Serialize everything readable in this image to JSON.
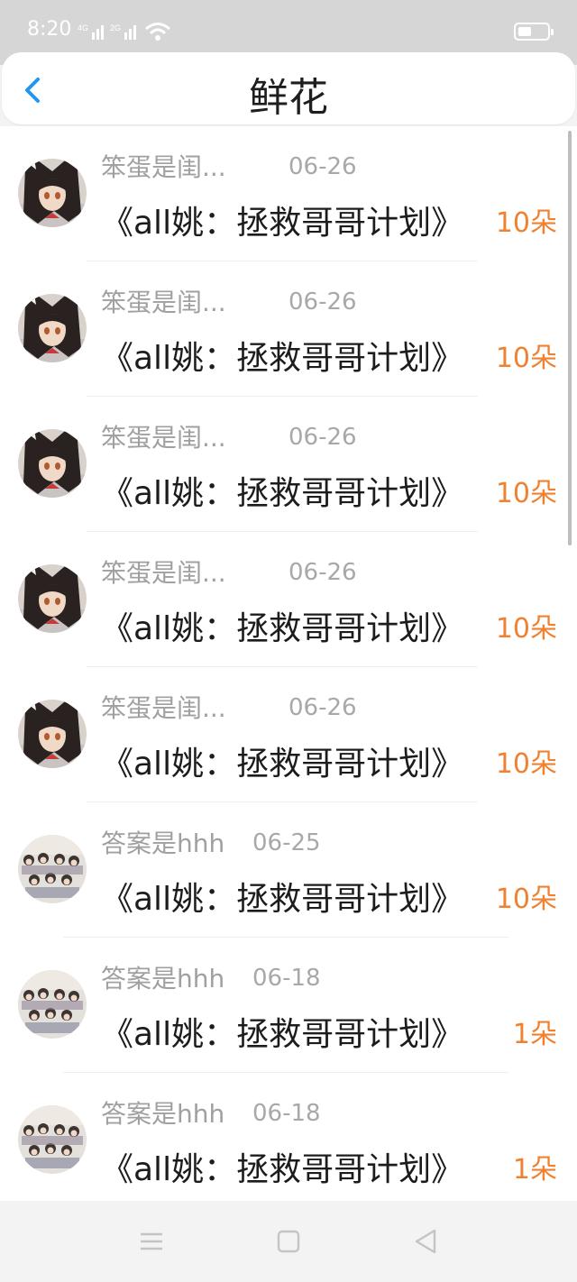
{
  "status_bar": {
    "time": "8:20",
    "signal_1": "4G",
    "signal_2": "2G",
    "icons": [
      "signal-icon",
      "wifi-icon",
      "battery-icon"
    ]
  },
  "header": {
    "title": "鲜花",
    "back_icon": "chevron-left-icon"
  },
  "colors": {
    "accent": "#2196f3",
    "count": "#f08130",
    "muted": "#a0a0a0"
  },
  "items": [
    {
      "user": "笨蛋是闺...",
      "date": "06-26",
      "title": "《all姚：拯救哥哥计划》",
      "count": "10朵",
      "avatar": "anime-girl-avatar"
    },
    {
      "user": "笨蛋是闺...",
      "date": "06-26",
      "title": "《all姚：拯救哥哥计划》",
      "count": "10朵",
      "avatar": "anime-girl-avatar"
    },
    {
      "user": "笨蛋是闺...",
      "date": "06-26",
      "title": "《all姚：拯救哥哥计划》",
      "count": "10朵",
      "avatar": "anime-girl-avatar"
    },
    {
      "user": "笨蛋是闺...",
      "date": "06-26",
      "title": "《all姚：拯救哥哥计划》",
      "count": "10朵",
      "avatar": "anime-girl-avatar"
    },
    {
      "user": "笨蛋是闺...",
      "date": "06-26",
      "title": "《all姚：拯救哥哥计划》",
      "count": "10朵",
      "avatar": "anime-girl-avatar"
    },
    {
      "user": "答案是hhh",
      "date": "06-25",
      "title": "《all姚：拯救哥哥计划》",
      "count": "10朵",
      "avatar": "group-photo-avatar"
    },
    {
      "user": "答案是hhh",
      "date": "06-18",
      "title": "《all姚：拯救哥哥计划》",
      "count": "1朵",
      "avatar": "group-photo-avatar"
    },
    {
      "user": "答案是hhh",
      "date": "06-18",
      "title": "《all姚：拯救哥哥计划》",
      "count": "1朵",
      "avatar": "group-photo-avatar"
    }
  ],
  "nav": {
    "icons": [
      "menu-icon",
      "home-icon",
      "back-triangle-icon"
    ]
  }
}
